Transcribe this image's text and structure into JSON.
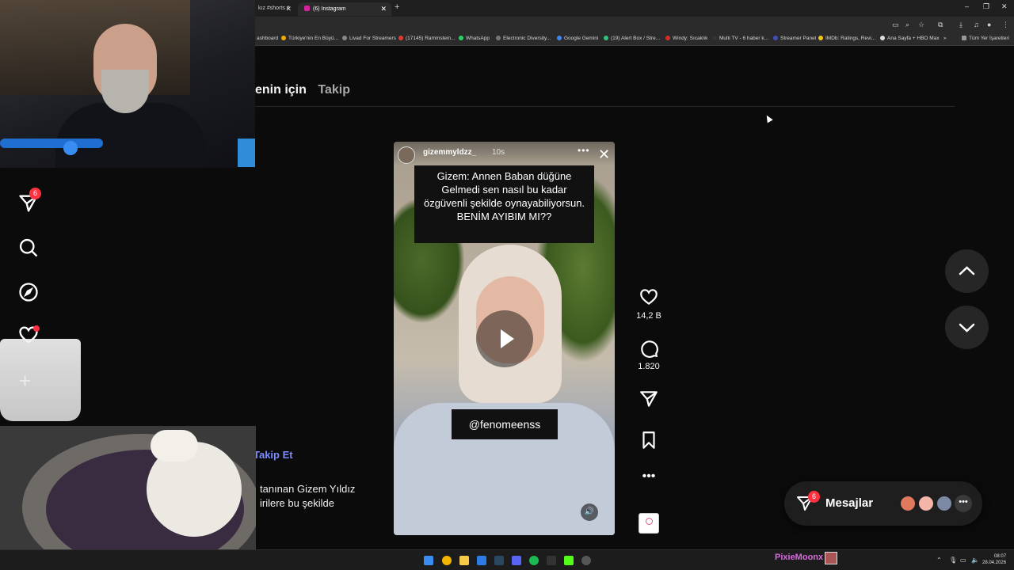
{
  "browser": {
    "tabs": [
      {
        "label": "kız #shorts #"
      },
      {
        "label": "(6) Instagram",
        "active": true
      }
    ],
    "bookmarks": [
      {
        "label": "ashboard",
        "color": "#444"
      },
      {
        "label": "Türkiye'nin En Büyü...",
        "color": "#f2a900"
      },
      {
        "label": "Livad For Streamers",
        "color": "#888"
      },
      {
        "label": "(17145) Rammstein...",
        "color": "#e53935"
      },
      {
        "label": "WhatsApp",
        "color": "#25d366"
      },
      {
        "label": "Electronic Diversity...",
        "color": "#777"
      },
      {
        "label": "Google Gemini",
        "color": "#4285f4"
      },
      {
        "label": "(19) Alert Box / Stre...",
        "color": "#31c27c"
      },
      {
        "label": "Windy: Sıcaklık",
        "color": "#d32f2f"
      },
      {
        "label": "Multi TV - 6 haber k...",
        "color": "#333"
      },
      {
        "label": "Streamer Panel",
        "color": "#3f51b5"
      },
      {
        "label": "IMDb: Ratings, Revi...",
        "color": "#f5c518"
      },
      {
        "label": "Ana Sayfa + HBO Max",
        "color": "#ddd"
      },
      {
        "label": "»",
        "color": ""
      },
      {
        "label": "Tüm Yer İşaretleri",
        "color": "#999"
      }
    ]
  },
  "feed": {
    "tabs": [
      "enin için",
      "Takip"
    ]
  },
  "sidebar": {
    "notifications_badge": "6"
  },
  "reel": {
    "username": "gizemmyldzz_",
    "time": "10s",
    "caption": "Gizem: Annen Baban düğüne Gelmedi sen nasıl bu kadar özgüvenli şekilde oynayabiliyorsun. BENİM AYIBIM MI??",
    "tag": "@fenomeenss",
    "likes": "14,2 B",
    "comments": "1.820"
  },
  "post": {
    "follow": "Takip Et",
    "text_line1": "tanınan Gizem Yıldız",
    "text_line2": "irilere bu şekilde"
  },
  "messages": {
    "label": "Mesajlar",
    "badge": "6"
  },
  "taskbar": {
    "streamer": "PixieMoonx",
    "time": "08:07",
    "date": "28.04.2026"
  }
}
